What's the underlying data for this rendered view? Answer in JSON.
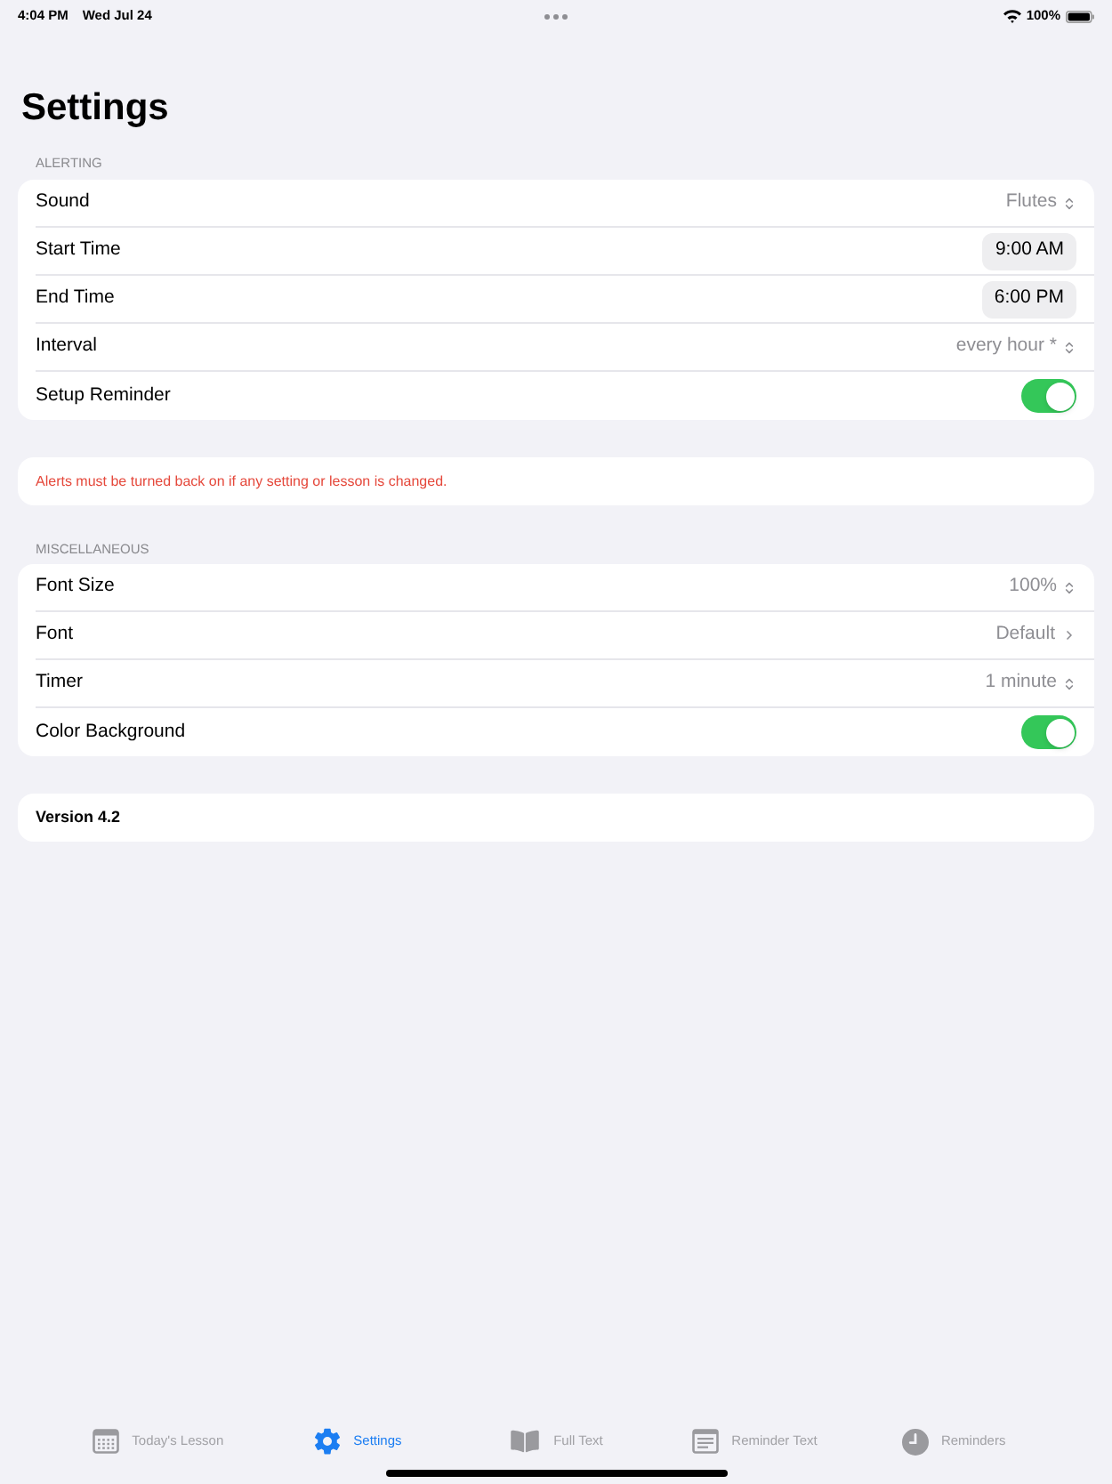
{
  "status_bar": {
    "time": "4:04 PM",
    "date": "Wed Jul 24",
    "battery": "100%"
  },
  "title": "Settings",
  "alerting": {
    "header": "ALERTING",
    "rows": [
      {
        "kind": "picker",
        "label": "Sound",
        "value": "Flutes"
      },
      {
        "kind": "time",
        "label": "Start Time",
        "value": "9:00 AM"
      },
      {
        "kind": "time",
        "label": "End Time",
        "value": "6:00 PM"
      },
      {
        "kind": "picker",
        "label": "Interval",
        "value": "every hour *"
      },
      {
        "kind": "toggle",
        "label": "Setup Reminder",
        "on": true
      }
    ]
  },
  "alert_note": "Alerts must be turned back on if any setting or lesson is changed.",
  "miscellaneous": {
    "header": "MISCELLANEOUS",
    "rows": [
      {
        "kind": "picker",
        "label": "Font Size",
        "value": "100%"
      },
      {
        "kind": "link",
        "label": "Font",
        "value": "Default"
      },
      {
        "kind": "picker",
        "label": "Timer",
        "value": "1 minute"
      },
      {
        "kind": "toggle",
        "label": "Color Background",
        "on": true
      }
    ]
  },
  "version": "Version 4.2",
  "tabs": [
    {
      "label": "Today's Lesson",
      "selected": false
    },
    {
      "label": "Settings",
      "selected": true
    },
    {
      "label": "Full Text",
      "selected": false
    },
    {
      "label": "Reminder Text",
      "selected": false
    },
    {
      "label": "Reminders",
      "selected": false
    }
  ]
}
